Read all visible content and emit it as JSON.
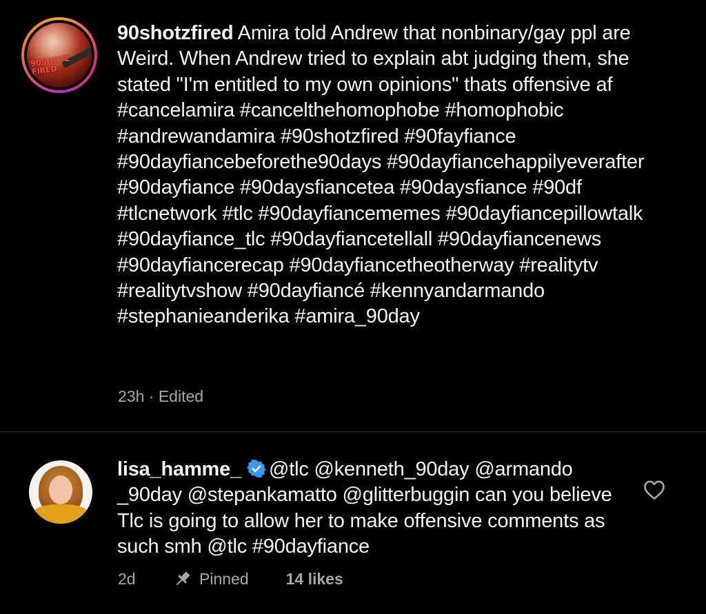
{
  "post": {
    "username": "90shotzfired",
    "avatar_text": "90SHOTZ FIRED",
    "caption_text": " Amira told Andrew that nonbinary/gay ppl are Weird. When Andrew tried to explain abt judging them, she stated \"I'm entitled to my own opinions\" thats offensive af #cancelamira #cancelthehomophobe #homophobic #andrewandamira #90shotzfired #90fayfiance #90dayfiancebeforethe90days #90dayfiancehappilyeverafter #90dayfiance #90daysfiancetea #90daysfiance #90df #tlcnetwork #tlc #90dayfiancememes #90dayfiancepillowtalk #90dayfiance_tlc #90dayfiancetellall #90dayfiancenews #90dayfiancerecap #90dayfiancetheotherway #realitytv #realitytvshow #90dayfiancé #kennyandarmando #stephanieanderika #amira_90day",
    "timestamp": "23h",
    "separator": "·",
    "edited_label": "Edited"
  },
  "comment": {
    "username": "lisa_hamme_",
    "verified": true,
    "text": "@tlc  @kenneth_90day @armando _90day @stepankamatto @glitterbuggin  can you believe Tlc is going to allow her to make offensive comments as such smh @tlc #90dayfiance",
    "timestamp": "2d",
    "pinned_label": "Pinned",
    "likes_label": "14 likes"
  },
  "icons": {
    "verified": "verified-badge-icon",
    "like": "heart-outline-icon",
    "pin": "pin-icon"
  },
  "colors": {
    "background": "#000000",
    "text": "#f5f5f5",
    "muted": "#a8a8a8",
    "verified_blue": "#3897f0",
    "divider": "#262626"
  }
}
